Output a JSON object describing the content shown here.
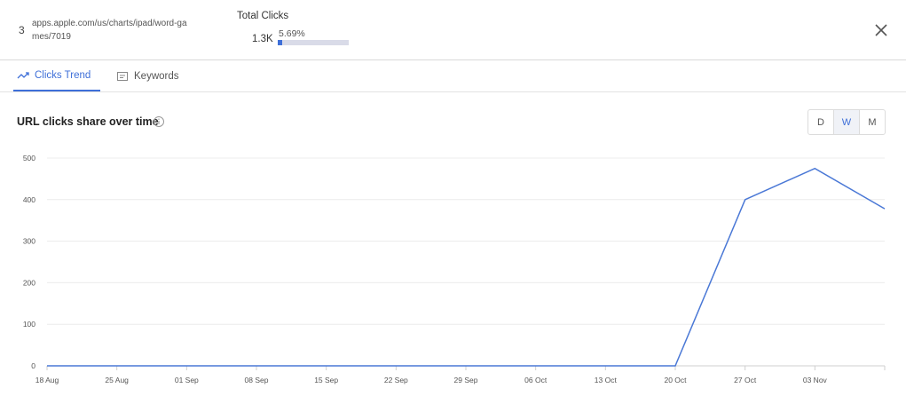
{
  "header": {
    "rank": "3",
    "url": "apps.apple.com/us/charts/ipad/word-games/7019",
    "total_clicks_label": "Total Clicks",
    "total_clicks_value": "1.3K",
    "share_text": "5.69%",
    "share_fraction": 0.0569
  },
  "icons": {
    "close": "close-icon",
    "trend": "trend-icon",
    "keywords": "keywords-icon",
    "info": "info-icon"
  },
  "tabs": [
    {
      "label": "Clicks Trend",
      "active": true
    },
    {
      "label": "Keywords",
      "active": false
    }
  ],
  "chart_title": "URL clicks share over time",
  "granularity": {
    "options": [
      "D",
      "W",
      "M"
    ],
    "selected": "W"
  },
  "colors": {
    "accent": "#3e6fd8",
    "line": "#4a78d6"
  },
  "chart_data": {
    "type": "line",
    "title": "URL clicks share over time",
    "xlabel": "",
    "ylabel": "",
    "ylim": [
      0,
      500
    ],
    "yticks": [
      0,
      100,
      200,
      300,
      400,
      500
    ],
    "x_tick_labels": [
      "18 Aug",
      "25 Aug",
      "01 Sep",
      "08 Sep",
      "15 Sep",
      "22 Sep",
      "29 Sep",
      "06 Oct",
      "13 Oct",
      "20 Oct",
      "27 Oct",
      "03 Nov"
    ],
    "x_dates": [
      "2019-08-15",
      "2019-08-22",
      "2019-08-29",
      "2019-09-05",
      "2019-09-12",
      "2019-09-19",
      "2019-09-26",
      "2019-10-03",
      "2019-10-10",
      "2019-10-17",
      "2019-10-24",
      "2019-10-31",
      "2019-11-07"
    ],
    "x_min": "2019-08-15",
    "x_max": "2019-11-07",
    "grid": true,
    "series": [
      {
        "points": [
          [
            "2019-08-15",
            0
          ],
          [
            "2019-10-17",
            0
          ],
          [
            "2019-10-24",
            400
          ],
          [
            "2019-10-31",
            475
          ],
          [
            "2019-11-07",
            378
          ]
        ]
      }
    ]
  }
}
